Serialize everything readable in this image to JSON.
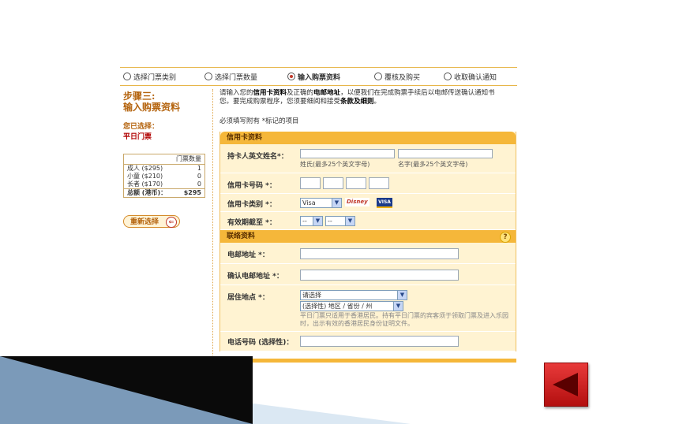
{
  "steps": [
    {
      "label": "选择门票类别",
      "active": false
    },
    {
      "label": "选择门票数量",
      "active": false
    },
    {
      "label": "输入购票资料",
      "active": true
    },
    {
      "label": "覆核及购买",
      "active": false
    },
    {
      "label": "收取确认通知",
      "active": false
    }
  ],
  "left": {
    "step_no": "步骤三:",
    "step_name": "输入购票资料",
    "selected_label": "您已选择：",
    "selected_value": "平日门票",
    "table_header": "门票数量",
    "rows": [
      {
        "label": "成人 ($295)",
        "qty": "1"
      },
      {
        "label": "小童 ($210)",
        "qty": "0"
      },
      {
        "label": "长者 ($170)",
        "qty": "0"
      }
    ],
    "total_label": "总额 (港币)：",
    "total_value": "$295",
    "reset_label": "重新选择",
    "reset_icon": "⇐"
  },
  "intro": {
    "line1_a": "请输入您的",
    "line1_b": "信用卡资料",
    "line1_c": "及正确的",
    "line1_d": "电邮地址",
    "line1_e": "，以便我们在完成购票手续后以电邮传送确认通知书",
    "line2_a": "您。要完成购票程序，您须要细阅和接受",
    "line2_b": "条款及细则",
    "line2_c": "。"
  },
  "required_note": "必须填写附有 *标记的项目",
  "credit": {
    "section_title": "信用卡资料",
    "holder_label": "持卡人英文姓名*：",
    "surname_hint": "姓氏(最多25个英文字母)",
    "given_hint": "名字(最多25个英文字母)",
    "number_label": "信用卡号码 *：",
    "type_label": "信用卡类别 *：",
    "type_value": "Visa",
    "card_logo_1": "Disney",
    "card_logo_2": "VISA",
    "expiry_label": "有效期截至 *：",
    "expiry_month": "--",
    "expiry_year": "--"
  },
  "contact": {
    "section_title": "联络资料",
    "help_icon": "?",
    "email_label": "电邮地址 *：",
    "confirm_label": "确认电邮地址 *：",
    "residence_label": "居住地点 *：",
    "residence_value": "请选择",
    "region_value": "(选择性) 地区 / 省份 / 州",
    "residence_note": "平日门票只适用于香港居民。持有平日门票的宾客须于领取门票及进入乐园时，出示有效的香港居民身份证明文件。",
    "phone_label": "电话号码 (选择性)："
  },
  "dropdown_arrow": "▼"
}
